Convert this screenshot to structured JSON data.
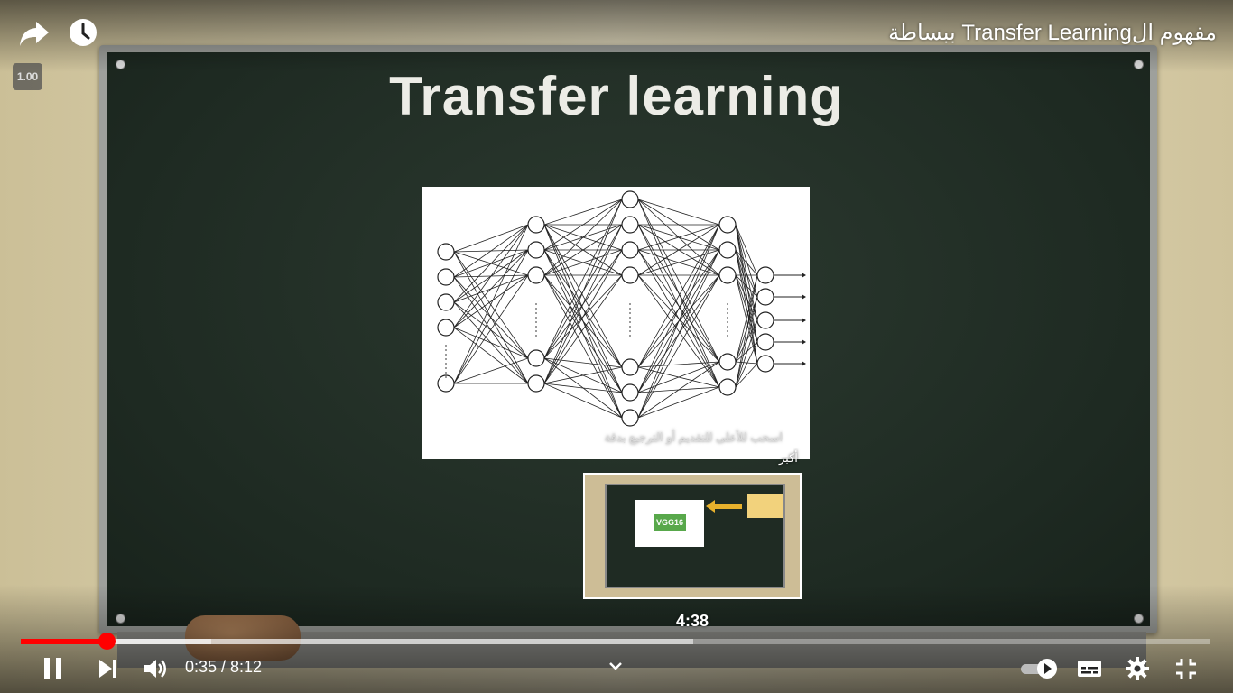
{
  "video": {
    "title": "مفهوم الTransfer Learning ببساطة",
    "speed_badge": "1.00"
  },
  "slide": {
    "title": "Transfer learning",
    "caption_line1": "اسحب للأعلى للتقديم أو الترجيع بدقة",
    "caption_line2": "أكبر"
  },
  "preview": {
    "time": "4:38",
    "chip_label": "VGG16"
  },
  "player": {
    "current_time": "0:35",
    "duration": "8:12",
    "time_text": "0:35 / 8:12",
    "played_fraction": 0.072,
    "buffered_fraction": 0.16,
    "hover_fraction": 0.565
  },
  "colors": {
    "progress_played": "#ff0000",
    "board": "#1e2a22"
  },
  "icons": {
    "share": "share-icon",
    "watch_later": "clock-icon",
    "pause": "pause-icon",
    "next": "next-icon",
    "volume": "volume-icon",
    "chevron": "chevron-down-icon",
    "autoplay": "autoplay-toggle-icon",
    "captions": "captions-icon",
    "settings": "gear-icon",
    "fullscreen": "exit-fullscreen-icon"
  }
}
